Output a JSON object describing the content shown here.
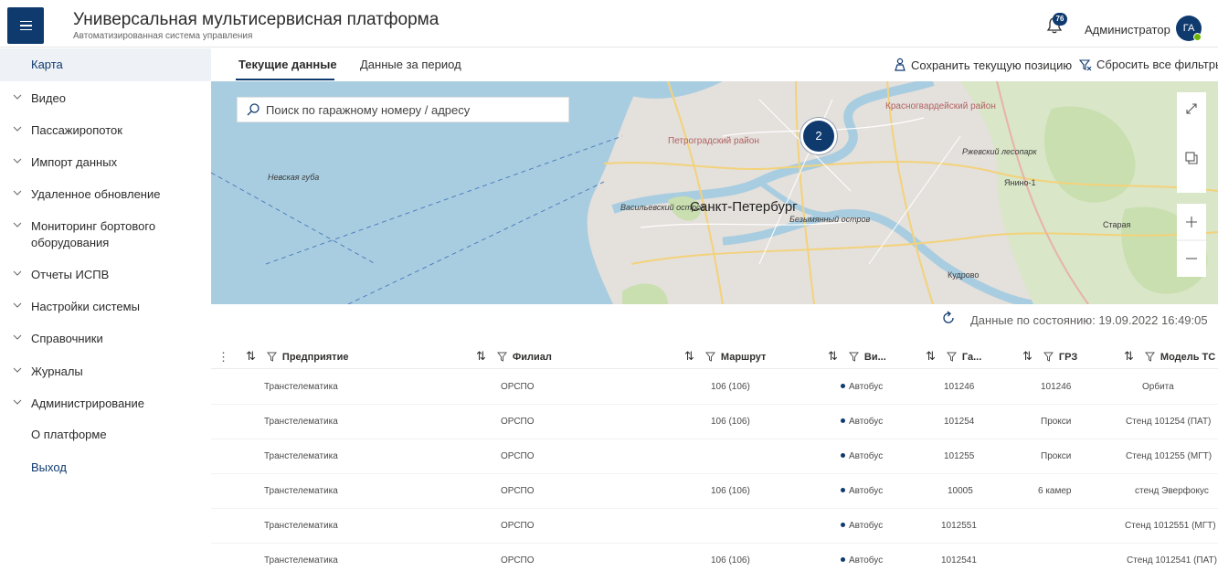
{
  "header": {
    "title": "Универсальная мультисервисная платформа",
    "subtitle": "Автоматизированная система управления",
    "notification_count": "76",
    "user_name": "Администратор",
    "avatar_initials": "ГА"
  },
  "sidebar": {
    "active_item": "Карта",
    "items": [
      {
        "label": "Видео"
      },
      {
        "label": "Пассажиропоток"
      },
      {
        "label": "Импорт данных"
      },
      {
        "label": "Удаленное обновление"
      },
      {
        "label": "Мониторинг бортового оборудования"
      },
      {
        "label": "Отчеты ИСПВ"
      },
      {
        "label": "Настройки системы"
      },
      {
        "label": "Справочники"
      },
      {
        "label": "Журналы"
      },
      {
        "label": "Администрирование"
      }
    ],
    "about": "О платформе",
    "logout": "Выход"
  },
  "tabs": {
    "current": "Текущие данные",
    "period": "Данные за период",
    "save_position": "Сохранить текущую позицию",
    "reset_filters": "Сбросить все фильтры"
  },
  "map": {
    "search_placeholder": "Поиск по гаражному номеру / адресу",
    "cluster_count": "2",
    "labels": {
      "city": "Санкт-Петербург",
      "petrogradsky": "Петроградский район",
      "krasnogvardeysky": "Красногвардейский район",
      "vasilyevsky": "Васильевский остров",
      "bezymyanny": "Безымянный остров",
      "nevskaya": "Невская губа",
      "yanino": "Янино-1",
      "staraya": "Старая",
      "kudrovo": "Кудрово",
      "rzhevsky": "Ржевский лесопарк"
    }
  },
  "status": {
    "text": "Данные по состоянию: 19.09.2022 16:49:05"
  },
  "table": {
    "columns": [
      "Предприятие",
      "Филиал",
      "Маршрут",
      "Ви...",
      "Га...",
      "ГРЗ",
      "Модель ТС"
    ],
    "rows": [
      {
        "enterprise": "Транстелематика",
        "branch": "ОРСПО",
        "route": "106 (106)",
        "type": "Автобус",
        "garage": "101246",
        "plate": "101246",
        "model": "Орбита"
      },
      {
        "enterprise": "Транстелематика",
        "branch": "ОРСПО",
        "route": "106 (106)",
        "type": "Автобус",
        "garage": "101254",
        "plate": "Прокси",
        "model": "Стенд 101254 (ПАТ)"
      },
      {
        "enterprise": "Транстелематика",
        "branch": "ОРСПО",
        "route": "",
        "type": "Автобус",
        "garage": "101255",
        "plate": "Прокси",
        "model": "Стенд 101255 (МГТ)"
      },
      {
        "enterprise": "Транстелематика",
        "branch": "ОРСПО",
        "route": "106 (106)",
        "type": "Автобус",
        "garage": "10005",
        "plate": "6 камер",
        "model": "стенд Эверфокус"
      },
      {
        "enterprise": "Транстелематика",
        "branch": "ОРСПО",
        "route": "",
        "type": "Автобус",
        "garage": "1012551",
        "plate": "",
        "model": "Стенд 1012551 (МГТ)"
      },
      {
        "enterprise": "Транстелематика",
        "branch": "ОРСПО",
        "route": "106 (106)",
        "type": "Автобус",
        "garage": "1012541",
        "plate": "",
        "model": "Стенд 1012541 (ПАТ)"
      }
    ]
  },
  "colors": {
    "accent": "#0f3a6e",
    "water": "#a9cde0",
    "park": "#c9dfb0",
    "urban": "#e4e0dc",
    "online": "#6bb700"
  }
}
